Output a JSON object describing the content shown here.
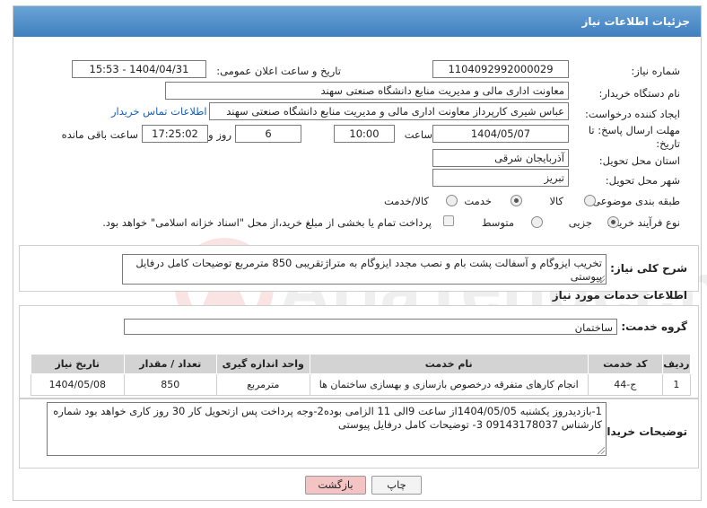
{
  "title": "جزئیات اطلاعات نیاز",
  "fields": {
    "need_number_label": "شماره نیاز:",
    "need_number": "1104092992000029",
    "announce_label": "تاریخ و ساعت اعلان عمومی:",
    "announce_value": "1404/04/31 - 15:53",
    "buyer_label": "نام دستگاه خریدار:",
    "buyer_value": "معاونت اداری  مالی و مدیریت منابع دانشگاه صنعتی سهند",
    "creator_label": "ایجاد کننده درخواست:",
    "creator_value": "عباس شیری کارپرداز معاونت اداری  مالی و مدیریت منابع دانشگاه صنعتی سهند",
    "contact_link": "اطلاعات تماس خریدار",
    "deadline_label_1": "مهلت ارسال پاسخ: تا",
    "deadline_label_2": "تاریخ:",
    "deadline_date": "1404/05/07",
    "time_label": "ساعت",
    "deadline_time": "10:00",
    "days_value": "6",
    "days_label": "روز و",
    "remaining_time": "17:25:02",
    "remaining_label": "ساعت باقی مانده",
    "province_label": "استان محل تحویل:",
    "province_value": "آذربایجان شرقی",
    "city_label": "شهر محل تحویل:",
    "city_value": "تبریز",
    "category_label": "طبقه بندی موضوعی:",
    "category_options": [
      "کالا",
      "خدمت",
      "کالا/خدمت"
    ],
    "category_selected": 1,
    "process_label": "نوع فرآیند خرید :",
    "process_options": [
      "جزیی",
      "متوسط"
    ],
    "process_selected": 0,
    "treasury_note": "پرداخت تمام یا بخشی از مبلغ خرید،از محل \"اسناد خزانه اسلامی\" خواهد بود."
  },
  "summary": {
    "label": "شرح کلی نیاز:",
    "text": "تخریب ایزوگام و آسفالت پشت بام و نصب مجدد ایزوگام به متراژتقریبی 850 مترمربع توضیحات کامل درفایل پیوستی"
  },
  "services": {
    "section_title": "اطلاعات خدمات مورد نیاز",
    "group_label": "گروه خدمت:",
    "group_value": "ساختمان",
    "columns": [
      "ردیف",
      "کد خدمت",
      "نام خدمت",
      "واحد اندازه گیری",
      "تعداد / مقدار",
      "تاریخ نیاز"
    ],
    "rows": [
      [
        "1",
        "ج-44",
        "انجام کارهای متفرقه درخصوص بازسازی و بهسازی ساختمان ها",
        "مترمربع",
        "850",
        "1404/05/08"
      ]
    ]
  },
  "buyer_notes": {
    "label": "توضیحات خریدار:",
    "text": "1-بازدیدروز یکشنبه 1404/05/05از ساعت 9الی 11 الزامی بوده2-وجه پرداخت پس ازتحویل کار 30 روز کاری خواهد بود شماره کارشناس 09143178037  3- توضیحات کامل درفایل پیوستی"
  },
  "buttons": {
    "print": "چاپ",
    "back": "بازگشت"
  },
  "watermark_text": "AriaTender.neT",
  "colors": {
    "title_bar": "#4f8dc9",
    "back_button": "#f4c4c4",
    "link": "#1a5fb4"
  }
}
